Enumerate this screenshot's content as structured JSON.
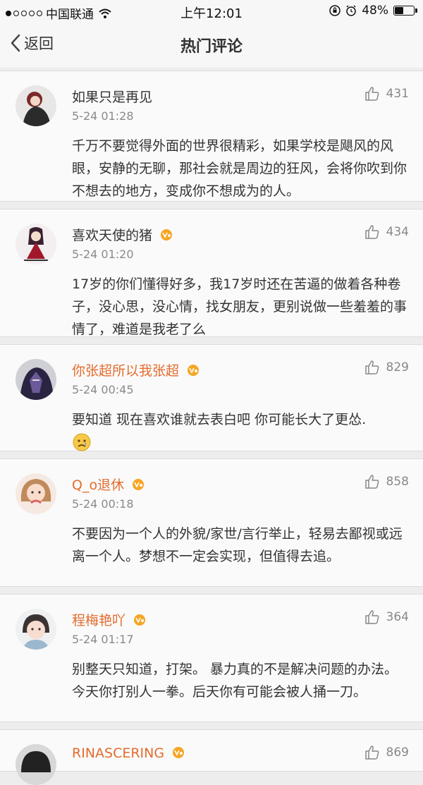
{
  "status_bar": {
    "carrier": "中国联通",
    "time": "上午12:01",
    "battery": "48%",
    "battery_level": 0.48,
    "signal_icon": "signal-dots-icon",
    "wifi_icon": "wifi-icon",
    "lock_icon": "rotation-lock-icon",
    "alarm_icon": "alarm-icon"
  },
  "nav": {
    "back_label": "返回",
    "back_icon": "chevron-left-icon",
    "title": "热门评论"
  },
  "colors": {
    "vip_name": "#e46c2d",
    "background": "#ededed",
    "card": "#fafafa"
  },
  "comments": [
    {
      "name": "如果只是再见",
      "vip": false,
      "time": "5-24 01:28",
      "likes": "431",
      "text": "千万不要觉得外面的世界很精彩，如果学校是飓风的风眼，安静的无聊，那社会就是周边的狂风，会将你吹到你不想去的地方，变成你不想成为的人。"
    },
    {
      "name": "喜欢天使的猪",
      "vip": true,
      "time": "5-24 01:20",
      "likes": "434",
      "text": "17岁的你们懂得好多，我17岁时还在苦逼的做着各种卷子，没心思，没心情，找女朋友，更别说做一些羞羞的事情了，难道是我老了么"
    },
    {
      "name": "你张超所以我张超",
      "vip": true,
      "time": "5-24 00:45",
      "likes": "829",
      "text": "要知道 现在喜欢谁就去表白吧 你可能长大了更怂.",
      "emoji": "sad-face-icon"
    },
    {
      "name": "Q_o退休",
      "vip": true,
      "time": "5-24 00:18",
      "likes": "858",
      "text": "不要因为一个人的外貌/家世/言行举止，轻易去鄙视或远离一个人。梦想不一定会实现，但值得去追。"
    },
    {
      "name": "程梅艳吖",
      "vip": true,
      "time": "5-24 01:17",
      "likes": "364",
      "text": "别整天只知道，打架。 暴力真的不是解决问题的办法。今天你打别人一拳。后天你有可能会被人捅一刀。"
    },
    {
      "name": "RINASCERING",
      "vip": true,
      "time": "",
      "likes": "869",
      "text": ""
    }
  ]
}
